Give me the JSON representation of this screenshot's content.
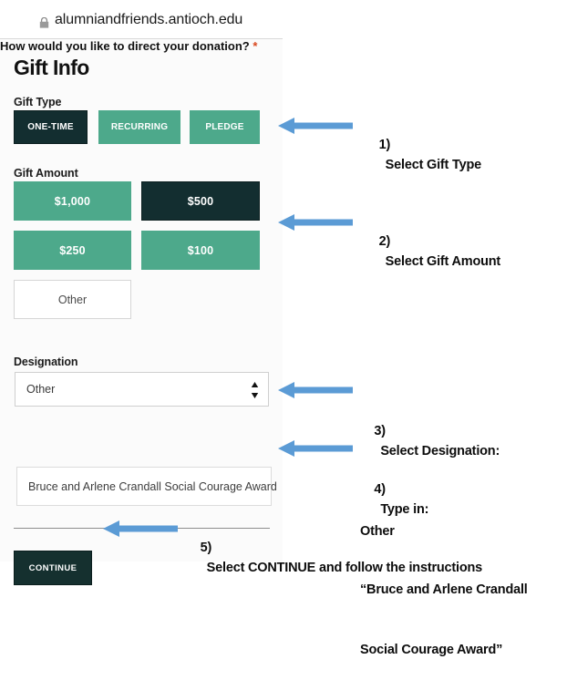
{
  "browser": {
    "lock_icon": "lock-icon",
    "url": "alumniandfriends.antioch.edu"
  },
  "page": {
    "title": "Gift Info",
    "gift_type": {
      "label": "Gift Type",
      "options": [
        {
          "label": "ONE-TIME",
          "selected": true
        },
        {
          "label": "RECURRING",
          "selected": false
        },
        {
          "label": "PLEDGE",
          "selected": false
        }
      ]
    },
    "gift_amount": {
      "label": "Gift Amount",
      "options": [
        {
          "label": "$1,000",
          "selected": false
        },
        {
          "label": "$500",
          "selected": true
        },
        {
          "label": "$250",
          "selected": false
        },
        {
          "label": "$100",
          "selected": false
        },
        {
          "label": "Other",
          "selected": false
        }
      ]
    },
    "designation": {
      "label": "Designation",
      "value": "Other",
      "spinner_icon": "select-spinner-icon"
    },
    "direct_donation": {
      "label": "How would you like to direct your donation?",
      "required_marker": "*",
      "value": "Bruce and Arlene Crandall Social Courage Award"
    },
    "continue_label": "CONTINUE"
  },
  "annotations": [
    {
      "step": "1)",
      "text": "Select Gift Type"
    },
    {
      "step": "2)",
      "text": "Select Gift Amount"
    },
    {
      "step": "3)",
      "line1": "Select Designation:",
      "line2": "Other"
    },
    {
      "step": "4)",
      "line1": "Type in:",
      "line2": "“Bruce and Arlene Crandall",
      "line3": "Social Courage Award”"
    },
    {
      "step": "5)",
      "text": "Select CONTINUE and follow the instructions"
    }
  ],
  "colors": {
    "green": "#4da98b",
    "dark": "#132e30",
    "arrow_blue": "#5b9bd5",
    "required_red": "#d9481f"
  }
}
